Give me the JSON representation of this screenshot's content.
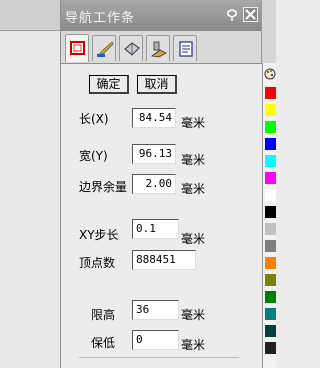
{
  "panel": {
    "title": "导航工作条",
    "tabs": [
      "frame-tab",
      "brush-tab",
      "shape-tab",
      "tool-tab",
      "document-tab"
    ],
    "confirm_label": "确定",
    "cancel_label": "取消",
    "length_label": "长(X)",
    "length_value": "84.54",
    "width_label": "宽(Y)",
    "width_value": "96.13",
    "margin_label": "边界余量",
    "margin_value": "2.00",
    "step_label": "XY步长",
    "step_value": "0.1",
    "vertex_label": "顶点数",
    "vertex_value": "888451",
    "limit_high_label": "限高",
    "limit_high_value": "36",
    "keep_low_label": "保低",
    "keep_low_value": "0",
    "unit": "毫米"
  },
  "palette": {
    "colors": [
      "#ff0000",
      "#ffff00",
      "#00ff00",
      "#0000ff",
      "#00ffff",
      "#ff00ff",
      "#ffffff",
      "#000000",
      "#c0c0c0",
      "#808080",
      "#ff8000",
      "#808000",
      "#008000",
      "#008080",
      "#004040",
      "#202020"
    ]
  }
}
